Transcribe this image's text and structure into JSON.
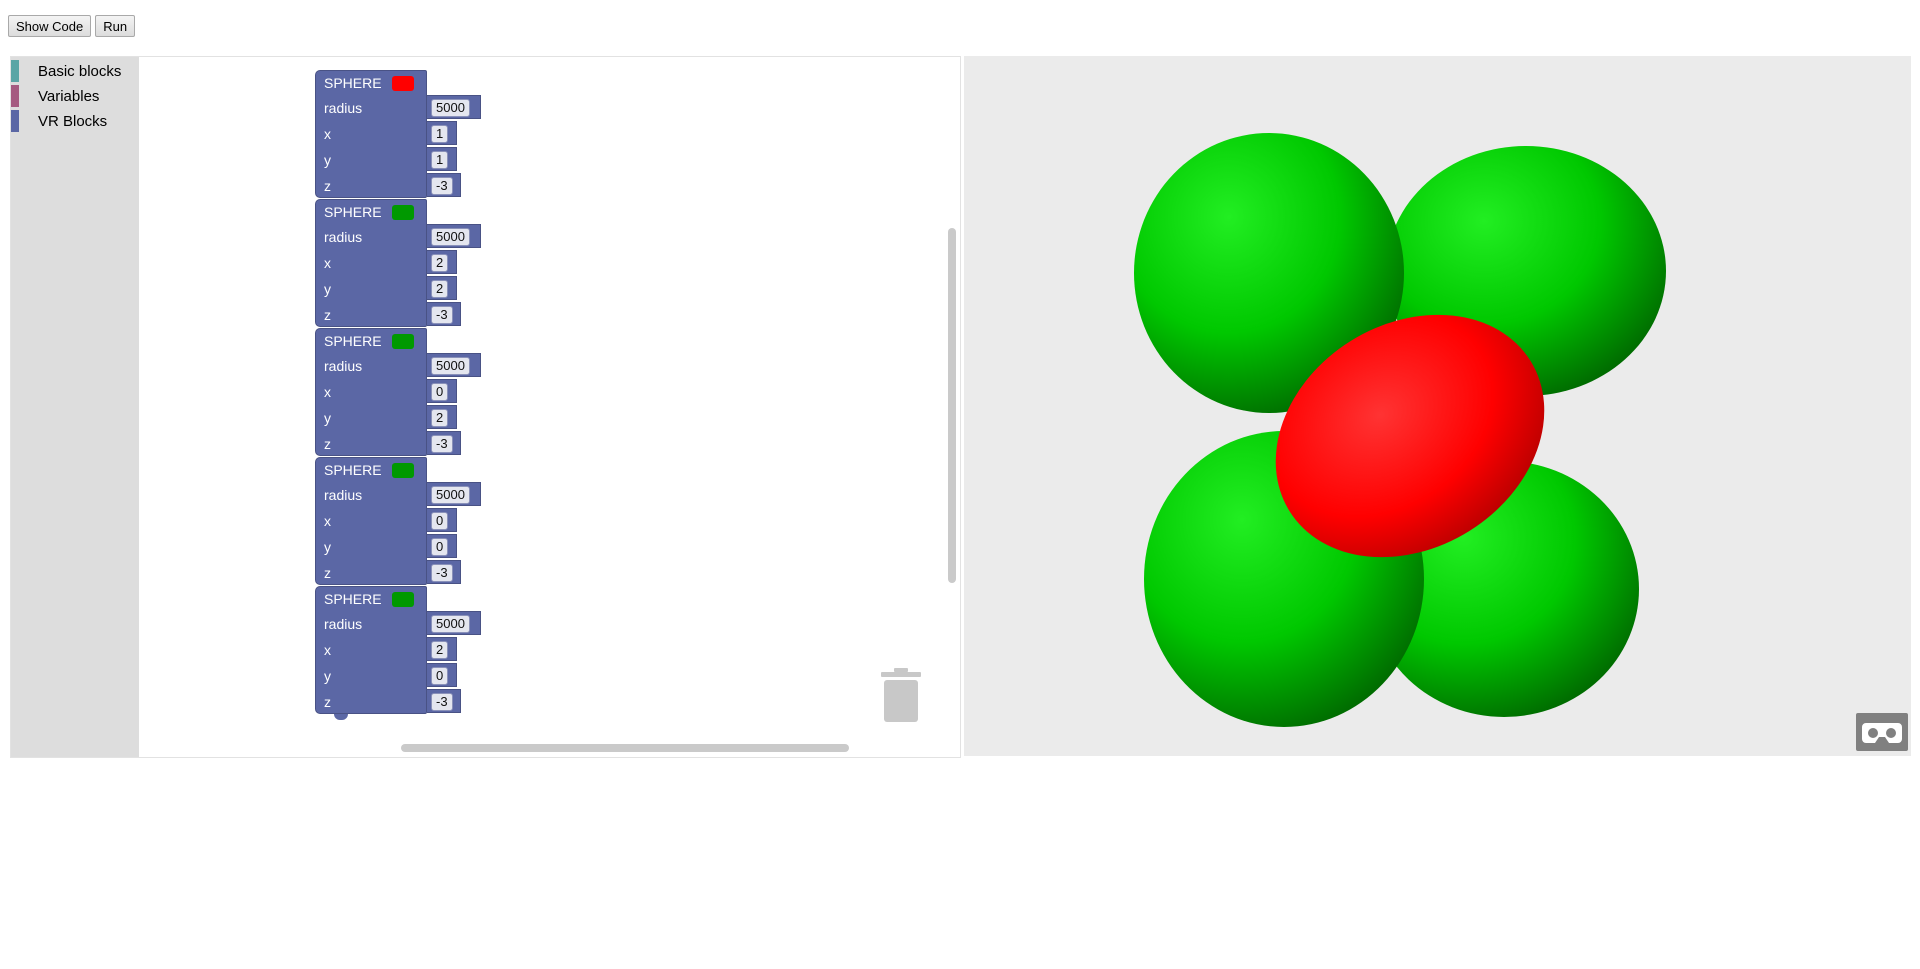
{
  "toolbar": {
    "show_code_label": "Show Code",
    "run_label": "Run"
  },
  "toolbox": {
    "categories": [
      {
        "label": "Basic blocks",
        "color": "#5ba5a5"
      },
      {
        "label": "Variables",
        "color": "#a55b80"
      },
      {
        "label": "VR Blocks",
        "color": "#5b67a5"
      }
    ]
  },
  "blocks": {
    "block_label": "SPHERE",
    "field_labels": {
      "radius": "radius",
      "x": "x",
      "y": "y",
      "z": "z"
    },
    "items": [
      {
        "color": "#ff0000",
        "radius": "5000",
        "x": "1",
        "y": "1",
        "z": "-3"
      },
      {
        "color": "#009900",
        "radius": "5000",
        "x": "2",
        "y": "2",
        "z": "-3"
      },
      {
        "color": "#009900",
        "radius": "5000",
        "x": "0",
        "y": "2",
        "z": "-3"
      },
      {
        "color": "#009900",
        "radius": "5000",
        "x": "0",
        "y": "0",
        "z": "-3"
      },
      {
        "color": "#009900",
        "radius": "5000",
        "x": "2",
        "y": "0",
        "z": "-3"
      }
    ]
  },
  "viewer": {
    "background": "#ebebeb",
    "red": "#ff0000",
    "green": "#00cc00"
  },
  "icons": {
    "trash": "trash-icon",
    "vr": "cardboard-vr-icon"
  }
}
